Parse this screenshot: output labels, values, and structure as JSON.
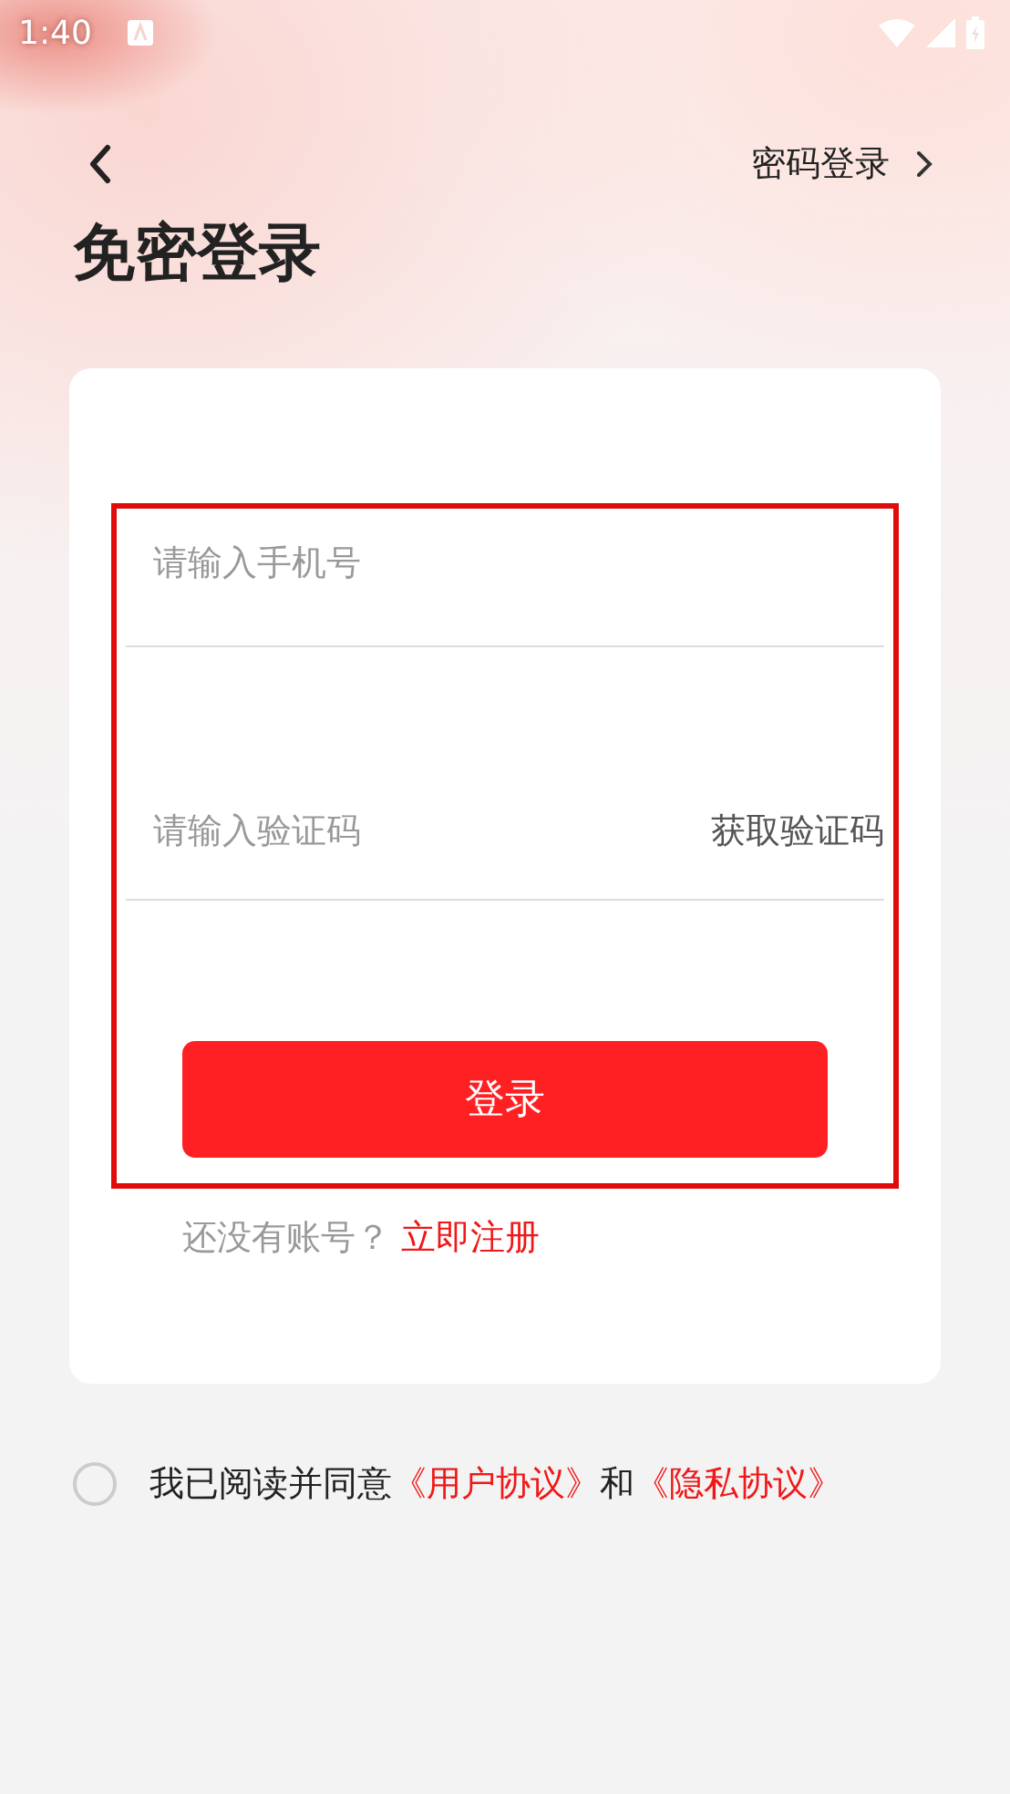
{
  "status_bar": {
    "time": "1:40"
  },
  "header": {
    "switch_link": "密码登录"
  },
  "title": "免密登录",
  "form": {
    "highlighted": true,
    "phone_field": {
      "placeholder": "请输入手机号"
    },
    "code_field": {
      "placeholder": "请输入验证码"
    },
    "get_code_button": "获取验证码",
    "login_button": "登录"
  },
  "register": {
    "prompt": "还没有账号？",
    "link": "立即注册"
  },
  "agreement": {
    "checked": false,
    "text_before": "我已阅读并同意",
    "user_agreement": "《用户协议》",
    "connector": "和",
    "privacy_policy": "《隐私协议》"
  }
}
